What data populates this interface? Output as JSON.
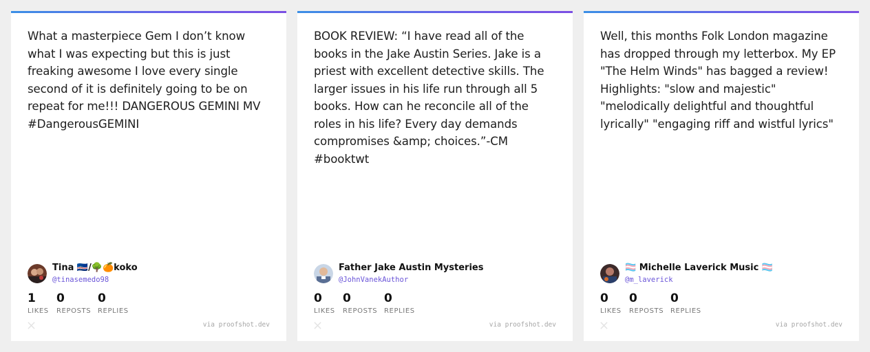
{
  "cards": [
    {
      "text": "What a masterpiece Gem I don’t know what I was expecting but this is just freaking awesome I love every single second of it is definitely going to be on repeat for me!!! DANGEROUS GEMINI MV #DangerousGEMINI",
      "author": {
        "name": "Tina 🇨🇻/🌳🍊koko",
        "handle": "@tinasemedo98"
      },
      "stats": {
        "likes": "1",
        "reposts": "0",
        "replies": "0"
      },
      "labels": {
        "likes": "LIKES",
        "reposts": "REPOSTS",
        "replies": "REPLIES"
      },
      "via": "via proofshot.dev",
      "avatar_color": "#6b3a2a"
    },
    {
      "text": "BOOK REVIEW: “I have read all of the books in the Jake Austin Series. Jake is a priest with excellent detective skills. The larger issues in his life run through all 5 books. How can he reconcile all of the roles in his life? Every day demands compromises &amp; choices.”-CM #booktwt",
      "author": {
        "name": "Father Jake Austin Mysteries",
        "handle": "@JohnVanekAuthor"
      },
      "stats": {
        "likes": "0",
        "reposts": "0",
        "replies": "0"
      },
      "labels": {
        "likes": "LIKES",
        "reposts": "REPOSTS",
        "replies": "REPLIES"
      },
      "via": "via proofshot.dev",
      "avatar_color": "#8aa4c8"
    },
    {
      "text": "Well, this months Folk London magazine has dropped through my letterbox. My EP \"The Helm Winds\" has bagged a review! Highlights: \"slow and majestic\" \"melodically delightful and thoughtful lyrically\" \"engaging riff and wistful lyrics\"",
      "author": {
        "name": "🏳️‍⚧️ Michelle Laverick Music 🏳️‍⚧️",
        "handle": "@m_laverick"
      },
      "stats": {
        "likes": "0",
        "reposts": "0",
        "replies": "0"
      },
      "labels": {
        "likes": "LIKES",
        "reposts": "REPOSTS",
        "replies": "REPLIES"
      },
      "via": "via proofshot.dev",
      "avatar_color": "#3c2a2a"
    }
  ]
}
